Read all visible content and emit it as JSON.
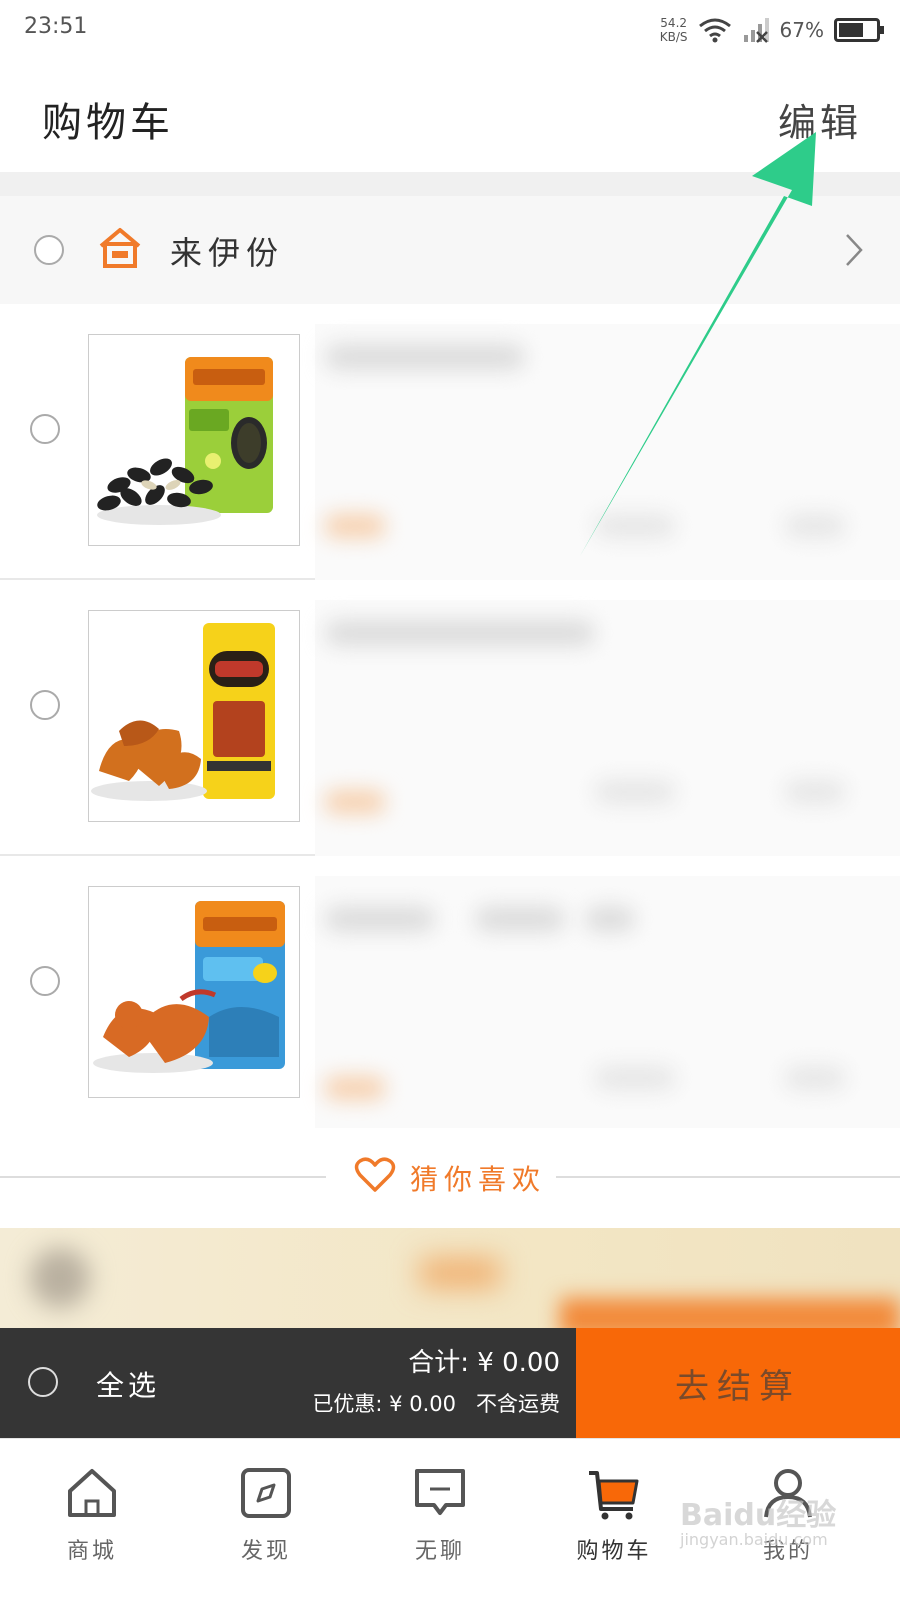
{
  "status_bar": {
    "time": "23:51",
    "net_speed_value": "54.2",
    "net_speed_unit": "KB/S",
    "battery": "67%",
    "battery_level": 0.67
  },
  "header": {
    "title": "购物车",
    "edit_label": "编辑"
  },
  "shop": {
    "name": "来伊份"
  },
  "cart_items": [
    {
      "product": "sunflower-seeds"
    },
    {
      "product": "duck-snack"
    },
    {
      "product": "scallop-snack"
    }
  ],
  "guess": {
    "label": "猜你喜欢"
  },
  "checkout": {
    "select_all": "全选",
    "total": "合计: ¥ 0.00",
    "discount": "已优惠: ¥ 0.00",
    "shipping_note": "不含运费",
    "checkout_label": "去结算"
  },
  "bottom_nav": {
    "items": [
      {
        "label": "商城",
        "icon": "home-icon"
      },
      {
        "label": "发现",
        "icon": "compass-icon"
      },
      {
        "label": "无聊",
        "icon": "chat-icon"
      },
      {
        "label": "购物车",
        "icon": "cart-icon",
        "active": true
      },
      {
        "label": "我的",
        "icon": "user-icon"
      }
    ]
  },
  "watermark": {
    "brand": "Baidu经验",
    "url": "jingyan.baidu.com"
  },
  "colors": {
    "accent": "#f86808",
    "checkout_bar": "#353535",
    "annotation_arrow": "#2ecc8a"
  }
}
